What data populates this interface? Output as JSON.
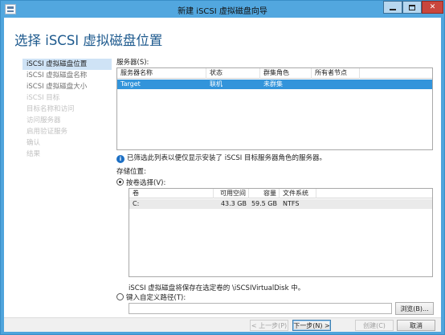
{
  "window": {
    "title": "新建 iSCSI 虚拟磁盘向导"
  },
  "page": {
    "heading": "选择 iSCSI 虚拟磁盘位置"
  },
  "steps": [
    {
      "label": "iSCSI 虚拟磁盘位置",
      "state": "current"
    },
    {
      "label": "iSCSI 虚拟磁盘名称",
      "state": "enabled"
    },
    {
      "label": "iSCSI 虚拟磁盘大小",
      "state": "enabled"
    },
    {
      "label": "iSCSI 目标",
      "state": "disabled"
    },
    {
      "label": "目标名称和访问",
      "state": "disabled"
    },
    {
      "label": "访问服务器",
      "state": "disabled"
    },
    {
      "label": "启用验证服务",
      "state": "disabled"
    },
    {
      "label": "确认",
      "state": "disabled"
    },
    {
      "label": "结果",
      "state": "disabled"
    }
  ],
  "servers": {
    "label": "服务器(S):",
    "columns": [
      "服务器名称",
      "状态",
      "群集角色",
      "所有者节点"
    ],
    "rows": [
      {
        "name": "Target",
        "status": "联机",
        "cluster_role": "未群集",
        "owner_node": ""
      }
    ]
  },
  "info_note": "已筛选此列表以便仅显示安装了 iSCSI 目标服务器角色的服务器。",
  "storage": {
    "label": "存储位置:",
    "by_volume_label": "按卷选择(V):",
    "volume_columns": [
      "卷",
      "可用空间",
      "容量",
      "文件系统"
    ],
    "volumes": [
      {
        "volume": "C:",
        "free": "43.3 GB",
        "capacity": "59.5 GB",
        "fs": "NTFS"
      }
    ],
    "save_note": "iSCSI 虚拟磁盘将保存在选定卷的 \\iSCSIVirtualDisk 中。",
    "custom_path_label": "键入自定义路径(T):",
    "custom_path_value": "",
    "browse_label": "浏览(B)..."
  },
  "buttons": {
    "prev": "< 上一步(P)",
    "next": "下一步(N) >",
    "create": "创建(C)",
    "cancel": "取消"
  }
}
